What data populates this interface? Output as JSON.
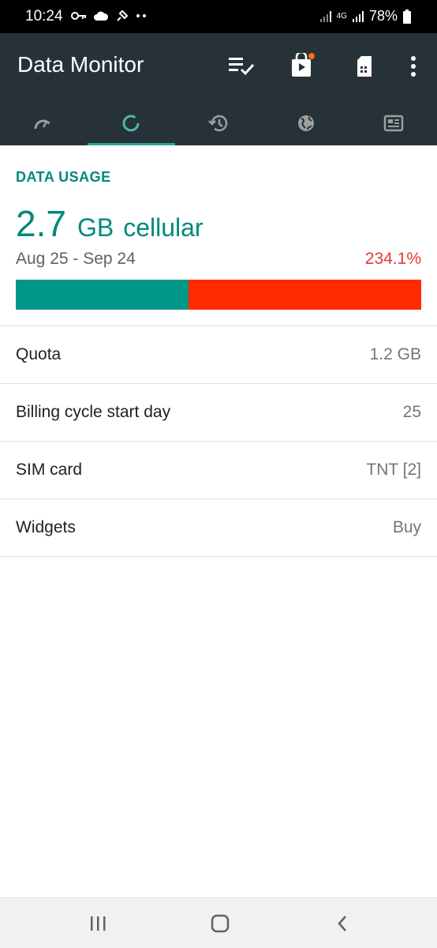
{
  "status_bar": {
    "time": "10:24",
    "battery_percent": "78%",
    "network": "4G",
    "icons": [
      "key-icon",
      "cloud-icon",
      "satellite-icon",
      "dots-icon",
      "signal-icon",
      "signal-icon",
      "battery-icon"
    ]
  },
  "app_bar": {
    "title": "Data Monitor",
    "actions": [
      "playlist-check-icon",
      "store-badge-icon",
      "sim-card-icon",
      "more-vert-icon"
    ],
    "notification_dot_color": "#ff6d00"
  },
  "tabs": [
    {
      "icon": "speedometer-icon",
      "active": false
    },
    {
      "icon": "donut-icon",
      "active": true
    },
    {
      "icon": "history-icon",
      "active": false
    },
    {
      "icon": "globe-icon",
      "active": false
    },
    {
      "icon": "widgets-icon",
      "active": false
    }
  ],
  "usage": {
    "section_label": "DATA USAGE",
    "value": "2.7",
    "unit": "GB",
    "type": "cellular",
    "period": "Aug 25 - Sep 24",
    "percent_text": "234.1%",
    "bar_quota_fraction": 0.427
  },
  "settings": [
    {
      "label": "Quota",
      "value": "1.2 GB"
    },
    {
      "label": "Billing cycle start day",
      "value": "25"
    },
    {
      "label": "SIM card",
      "value": "TNT [2]"
    },
    {
      "label": "Widgets",
      "value": "Buy"
    }
  ],
  "colors": {
    "app_bar": "#263238",
    "accent": "#00897b",
    "over_quota": "#ff2a00",
    "percent": "#e53935"
  },
  "nav": [
    "recents-icon",
    "home-icon",
    "back-icon"
  ]
}
